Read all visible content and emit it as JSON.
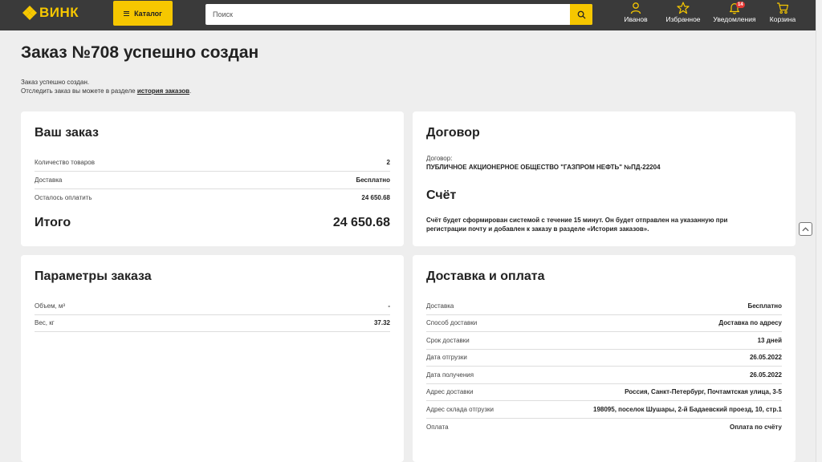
{
  "header": {
    "logo_text": "ВИНК",
    "catalog_label": "Каталог",
    "search_placeholder": "Поиск",
    "nav": [
      {
        "label": "Иванов",
        "icon": "user-icon"
      },
      {
        "label": "Избранное",
        "icon": "star-icon"
      },
      {
        "label": "Уведомления",
        "icon": "bell-icon",
        "badge": "14"
      },
      {
        "label": "Корзина",
        "icon": "cart-icon"
      }
    ],
    "accent_color": "#f6c700",
    "bg_color": "#3a3a3a"
  },
  "page": {
    "title": "Заказ №708 успешно создан",
    "intro_line1": "Заказ успешно создан.",
    "intro_line2_prefix": "Отследить заказ вы можете в разделе",
    "intro_link": "история заказов",
    "intro_suffix": "."
  },
  "order": {
    "title": "Ваш заказ",
    "rows": [
      {
        "key": "Количество товаров",
        "value": "2"
      },
      {
        "key": "Доставка",
        "value": "Бесплатно"
      },
      {
        "key": "Осталось оплатить",
        "value": "24 650.68"
      }
    ],
    "total_label": "Итого",
    "total_value": "24 650.68"
  },
  "contract": {
    "title": "Договор",
    "label": "Договор:",
    "value": "ПУБЛИЧНОЕ АКЦИОНЕРНОЕ ОБЩЕСТВО \"ГАЗПРОМ НЕФТЬ\" №ПД-22204",
    "invoice_title": "Счёт",
    "invoice_text": "Счёт будет сформирован системой с течение 15 минут. Он будет отправлен на указанную при регистрации почту и добавлен к заказу в разделе «История заказов»."
  },
  "params": {
    "title": "Параметры заказа",
    "rows": [
      {
        "key": "Объем, м³",
        "value": "-"
      },
      {
        "key": "Вес, кг",
        "value": "37.32"
      }
    ]
  },
  "delivery": {
    "title": "Доставка и оплата",
    "rows": [
      {
        "key": "Доставка",
        "value": "Бесплатно"
      },
      {
        "key": "Способ доставки",
        "value": "Доставка по адресу"
      },
      {
        "key": "Срок доставки",
        "value": "13 дней"
      },
      {
        "key": "Дата отгрузки",
        "value": "26.05.2022"
      },
      {
        "key": "Дата получения",
        "value": "26.05.2022"
      },
      {
        "key": "Адрес доставки",
        "value": "Россия, Санкт-Петербург, Почтамтская улица, 3-5"
      },
      {
        "key": "Адрес склада отгрузки",
        "value": "198095, поселок Шушары, 2-й Бадаевский проезд, 10, стр.1"
      },
      {
        "key": "Оплата",
        "value": "Оплата по счёту"
      }
    ]
  }
}
